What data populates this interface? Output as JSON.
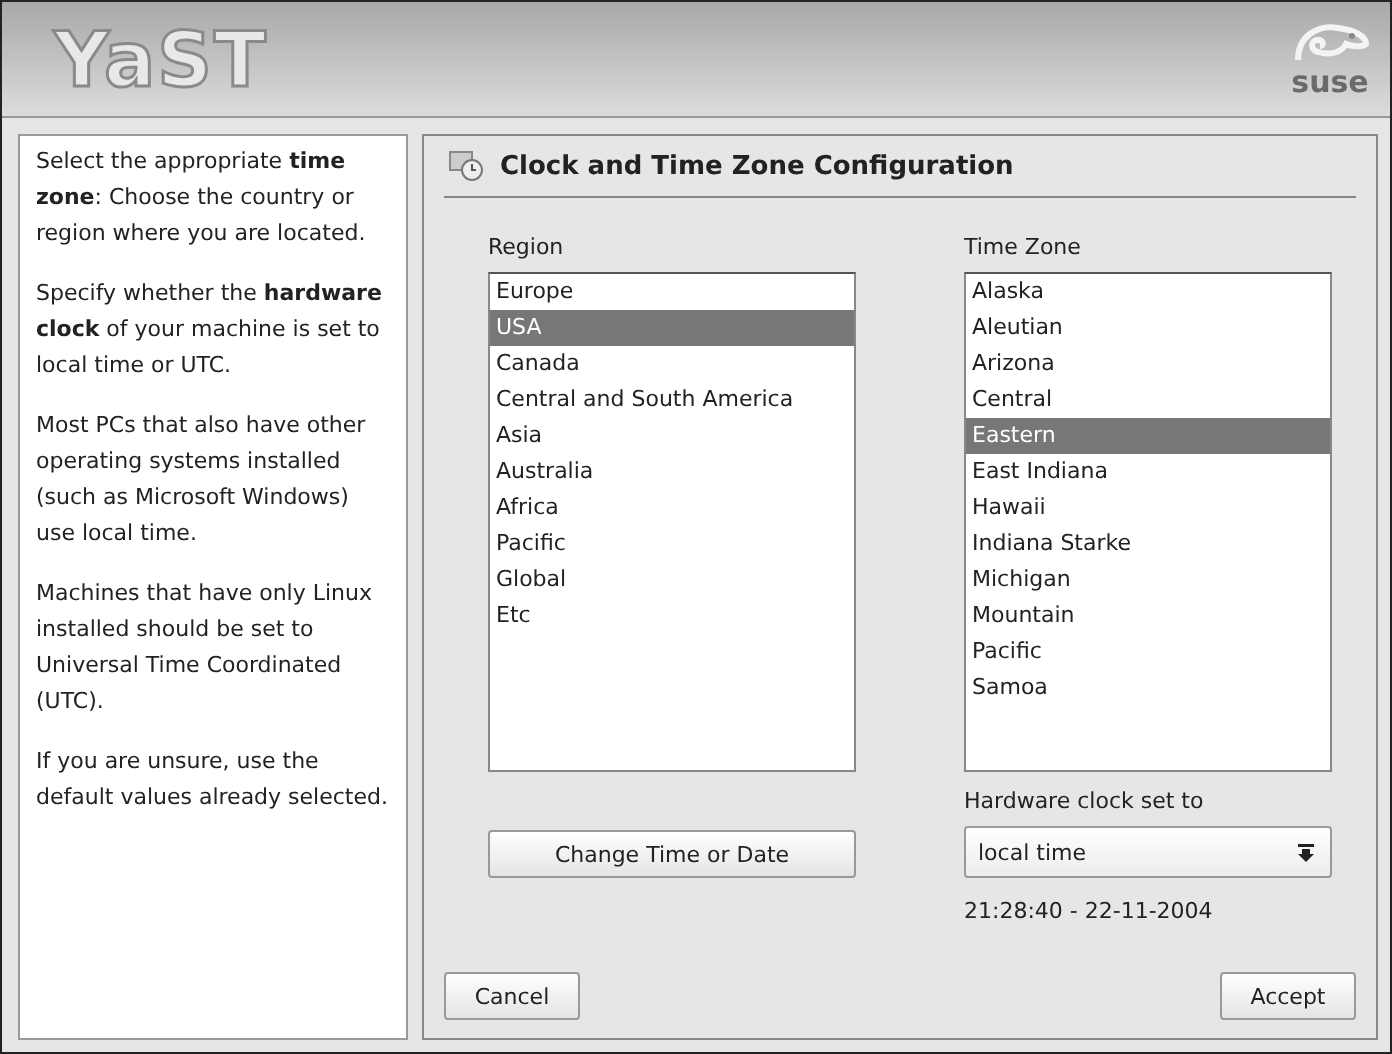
{
  "header": {
    "logo": "YaST",
    "brand": "suse"
  },
  "help": [
    "Select the appropriate **time zone**: Choose the country or region where you are located.",
    "Specify whether the **hardware clock** of your machine is set to local time or UTC.",
    "Most PCs that also have other operating systems installed (such as Microsoft Windows) use local time.",
    "Machines that have only Linux installed should be set to Universal Time Coordinated (UTC).",
    "If you are unsure, use the default values already selected."
  ],
  "dialog": {
    "title": "Clock and Time Zone Configuration"
  },
  "region": {
    "label": "Region",
    "items": [
      {
        "label": "Europe",
        "selected": false
      },
      {
        "label": "USA",
        "selected": true
      },
      {
        "label": "Canada",
        "selected": false
      },
      {
        "label": "Central and South America",
        "selected": false
      },
      {
        "label": "Asia",
        "selected": false
      },
      {
        "label": "Australia",
        "selected": false
      },
      {
        "label": "Africa",
        "selected": false
      },
      {
        "label": "Pacific",
        "selected": false
      },
      {
        "label": "Global",
        "selected": false
      },
      {
        "label": "Etc",
        "selected": false
      }
    ]
  },
  "time_zone": {
    "label": "Time Zone",
    "items": [
      {
        "label": "Alaska",
        "selected": false
      },
      {
        "label": "Aleutian",
        "selected": false
      },
      {
        "label": "Arizona",
        "selected": false
      },
      {
        "label": "Central",
        "selected": false
      },
      {
        "label": "Eastern",
        "selected": true
      },
      {
        "label": "East Indiana",
        "selected": false
      },
      {
        "label": "Hawaii",
        "selected": false
      },
      {
        "label": "Indiana Starke",
        "selected": false
      },
      {
        "label": "Michigan",
        "selected": false
      },
      {
        "label": "Mountain",
        "selected": false
      },
      {
        "label": "Pacific",
        "selected": false
      },
      {
        "label": "Samoa",
        "selected": false
      }
    ]
  },
  "change_button": "Change Time or Date",
  "hardware_clock": {
    "label": "Hardware clock set to",
    "value": "local time"
  },
  "current_time": "21:28:40 - 22-11-2004",
  "buttons": {
    "cancel": "Cancel",
    "accept": "Accept"
  }
}
